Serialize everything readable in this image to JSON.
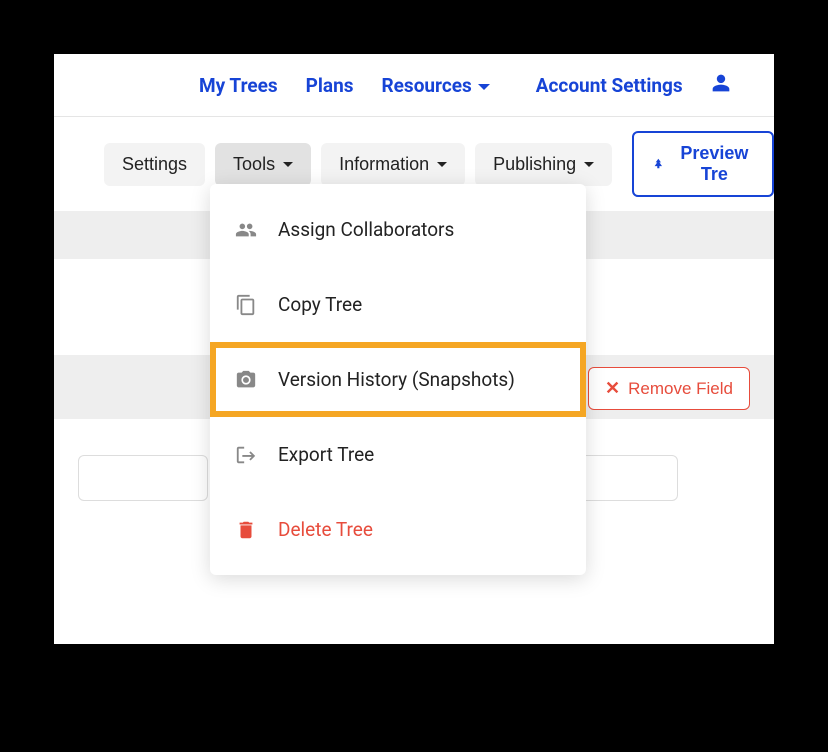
{
  "topnav": {
    "myTrees": "My Trees",
    "plans": "Plans",
    "resources": "Resources",
    "accountSettings": "Account Settings"
  },
  "toolbar": {
    "settings": "Settings",
    "tools": "Tools",
    "information": "Information",
    "publishing": "Publishing",
    "previewTree": "Preview Tre"
  },
  "removeField": "Remove Field",
  "dropdown": {
    "assignCollaborators": "Assign Collaborators",
    "copyTree": "Copy Tree",
    "versionHistory": "Version History (Snapshots)",
    "exportTree": "Export Tree",
    "deleteTree": "Delete Tree"
  }
}
